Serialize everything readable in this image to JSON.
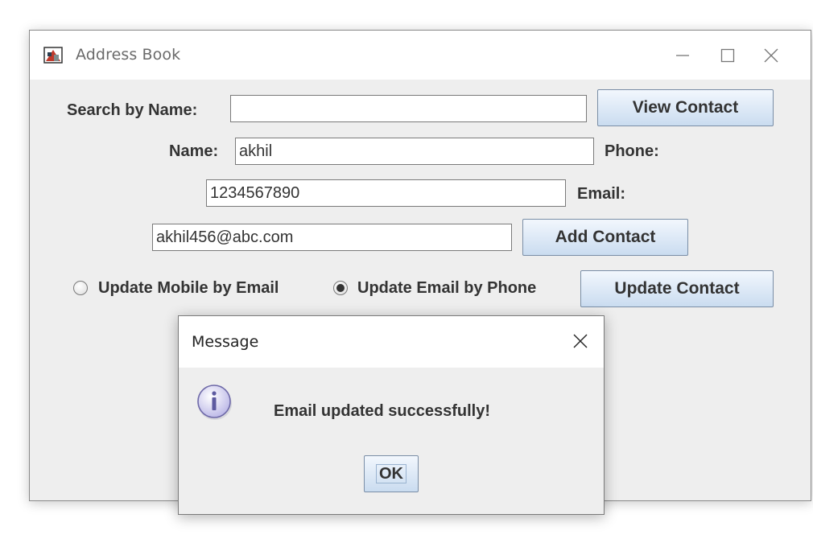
{
  "window": {
    "title": "Address Book",
    "icon": "address-book-app-icon",
    "controls": [
      "minimize-icon",
      "maximize-icon",
      "close-icon"
    ]
  },
  "form": {
    "search_label": "Search by Name:",
    "search_value": "",
    "view_button": "View Contact",
    "name_label": "Name:",
    "name_value": "akhil",
    "phone_label": "Phone:",
    "phone_value": "1234567890",
    "email_label": "Email:",
    "email_value": "akhil456@abc.com",
    "add_button": "Add Contact",
    "radio_options": [
      {
        "label": "Update Mobile by Email",
        "selected": false
      },
      {
        "label": "Update Email by Phone",
        "selected": true
      }
    ],
    "update_button": "Update Contact"
  },
  "dialog": {
    "title": "Message",
    "icon": "info-icon",
    "message": "Email updated successfully!",
    "ok_button": "OK"
  },
  "colors": {
    "window_bg": "#eeeeee",
    "button_gradient_top": "#f2f7fd",
    "button_gradient_bottom": "#cadcf0",
    "info_icon_fill": "#c9c6ec"
  }
}
